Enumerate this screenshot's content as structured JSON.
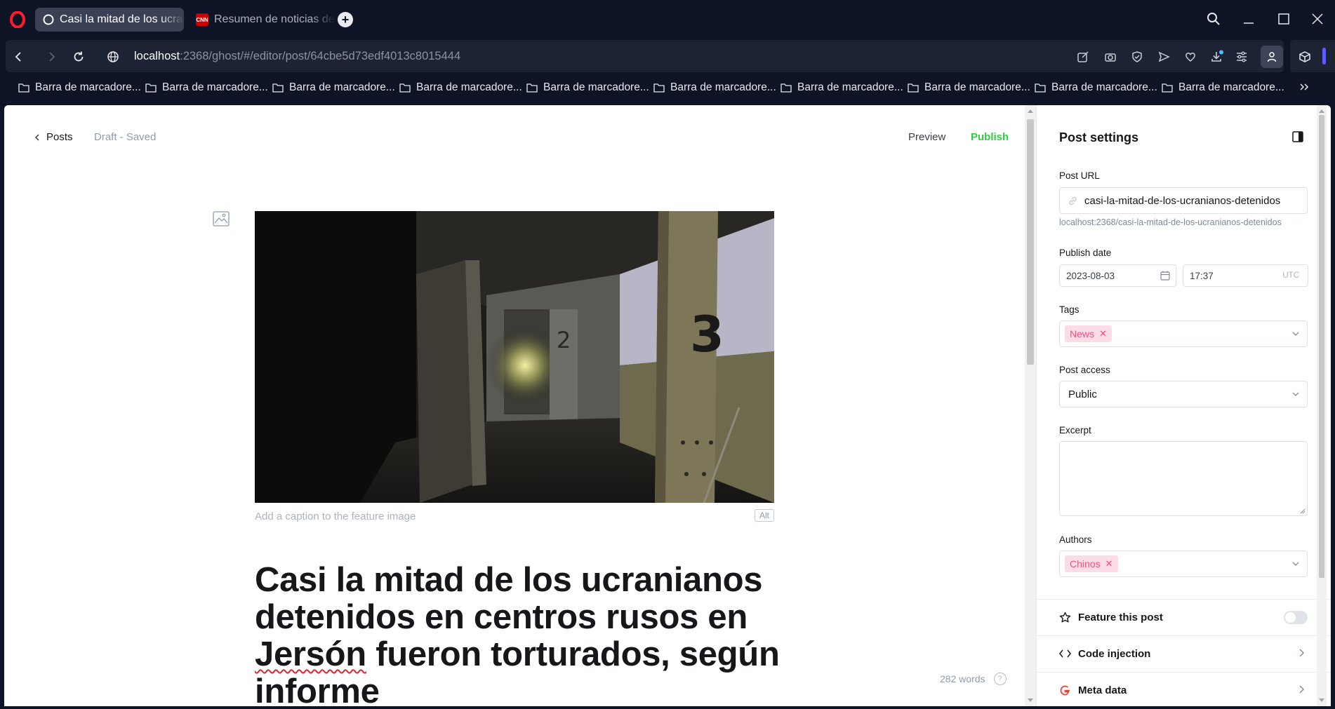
{
  "browser": {
    "tabs": [
      {
        "title": "Casi la mitad de los ucranianos",
        "favicon": "ghost-circle-icon"
      },
      {
        "title": "Resumen de noticias de la",
        "favicon": "cnn-logo",
        "favicon_text": "CNN"
      }
    ],
    "address": {
      "host": "localhost",
      "rest": ":2368/ghost/#/editor/post/64cbe5d73edf4013c8015444"
    },
    "bookmarks": [
      "Barra de marcadore...",
      "Barra de marcadore...",
      "Barra de marcadore...",
      "Barra de marcadore...",
      "Barra de marcadore...",
      "Barra de marcadore...",
      "Barra de marcadore...",
      "Barra de marcadore...",
      "Barra de marcadore...",
      "Barra de marcadore..."
    ]
  },
  "editor": {
    "back_label": "Posts",
    "status": "Draft - Saved",
    "preview_label": "Preview",
    "publish_label": "Publish",
    "caption_placeholder": "Add a caption to the feature image",
    "alt_label": "Alt",
    "title_part1": "Casi la mitad de los ucranianos detenidos en centros rusos en ",
    "title_misspelled": "Jersón",
    "title_part2": " fueron torturados, según informe",
    "word_count": "282 words",
    "help": "?"
  },
  "settings": {
    "title": "Post settings",
    "post_url_label": "Post URL",
    "post_url_value": "casi-la-mitad-de-los-ucranianos-detenidos",
    "post_url_hint": "localhost:2368/casi-la-mitad-de-los-ucranianos-detenidos",
    "publish_date_label": "Publish date",
    "publish_date": "2023-08-03",
    "publish_time": "17:37",
    "timezone": "UTC",
    "tags_label": "Tags",
    "tags": [
      "News"
    ],
    "access_label": "Post access",
    "access_value": "Public",
    "excerpt_label": "Excerpt",
    "authors_label": "Authors",
    "authors": [
      "Chinos"
    ],
    "feature_label": "Feature this post",
    "code_injection_label": "Code injection",
    "meta_data_label": "Meta data"
  },
  "colors": {
    "accent_green": "#30cf43",
    "tag_pink": "#f64c87",
    "tag_bg": "#fcdce5",
    "chrome_bg": "#0e1425"
  }
}
